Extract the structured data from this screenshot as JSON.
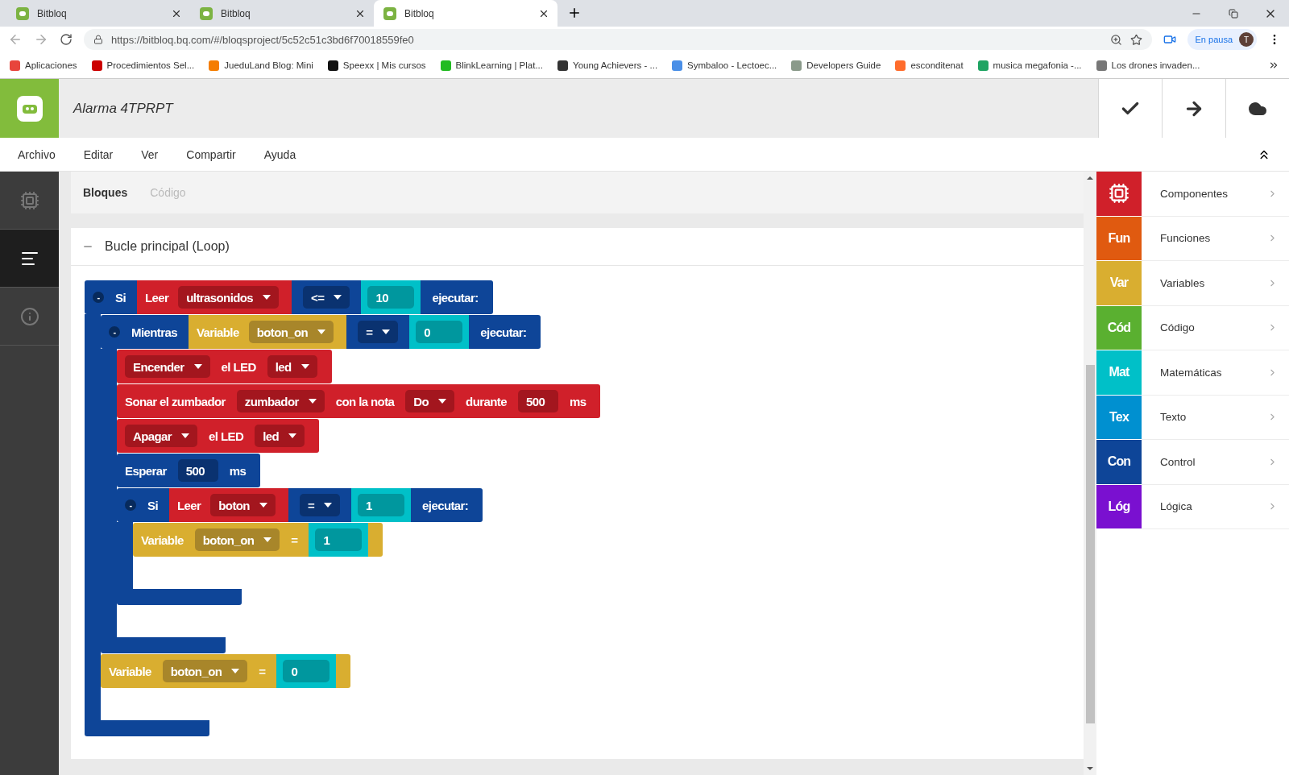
{
  "browser": {
    "tabs": [
      {
        "title": "Bitbloq",
        "selected": false
      },
      {
        "title": "Bitbloq",
        "selected": false
      },
      {
        "title": "Bitbloq",
        "selected": true
      }
    ],
    "url": "https://bitbloq.bq.com/#/bloqsproject/5c52c51c3bd6f70018559fe0",
    "profile": {
      "status": "En pausa",
      "initial": "T"
    },
    "bookmarks": [
      {
        "label": "Aplicaciones",
        "color": "#e8453c"
      },
      {
        "label": "Procedimientos Sel...",
        "color": "#cc0000"
      },
      {
        "label": "JueduLand Blog: Mini",
        "color": "#f57d00"
      },
      {
        "label": "Speexx | Mis cursos",
        "color": "#111111"
      },
      {
        "label": "BlinkLearning | Plat...",
        "color": "#22bb22"
      },
      {
        "label": "Young Achievers - ...",
        "color": "#333333"
      },
      {
        "label": "Symbaloo - Lectoec...",
        "color": "#4a8fe7"
      },
      {
        "label": "Developers Guide",
        "color": "#8a9a8a"
      },
      {
        "label": "esconditenat",
        "color": "#ff6c2c"
      },
      {
        "label": "musica megafonia -...",
        "color": "#1fa463"
      },
      {
        "label": "Los drones invaden...",
        "color": "#777777"
      }
    ]
  },
  "app": {
    "project_title": "Alarma 4TPRPT",
    "menu": [
      "Archivo",
      "Editar",
      "Ver",
      "Compartir",
      "Ayuda"
    ],
    "sidebar": [
      {
        "selected": false
      },
      {
        "selected": true
      },
      {
        "selected": false
      }
    ],
    "view_tabs": [
      {
        "label": "Bloques",
        "selected": true
      },
      {
        "label": "Código",
        "selected": false
      }
    ],
    "section": {
      "title": "Bucle principal (Loop)",
      "blocks": [
        {
          "kind": "control",
          "toggle": "-",
          "parts": [
            {
              "kind": "text",
              "text": "Si"
            },
            {
              "kind": "component_value",
              "parts": [
                {
                  "kind": "text",
                  "text": "Leer"
                },
                {
                  "kind": "dropdown",
                  "text": "ultrasonidos"
                }
              ]
            },
            {
              "kind": "dropdown",
              "text": "<="
            },
            {
              "kind": "socket",
              "text": "10"
            },
            {
              "kind": "text",
              "text": "ejecutar:"
            }
          ],
          "children": [
            {
              "kind": "control",
              "toggle": "-",
              "parts": [
                {
                  "kind": "text",
                  "text": "Mientras"
                },
                {
                  "kind": "variable_value",
                  "parts": [
                    {
                      "kind": "text",
                      "text": "Variable"
                    },
                    {
                      "kind": "dropdown",
                      "text": "boton_on"
                    }
                  ]
                },
                {
                  "kind": "dropdown",
                  "text": "="
                },
                {
                  "kind": "socket",
                  "text": "0"
                },
                {
                  "kind": "text",
                  "text": "ejecutar:"
                }
              ],
              "children": [
                {
                  "kind": "component",
                  "parts": [
                    {
                      "kind": "dropdown",
                      "text": "Encender"
                    },
                    {
                      "kind": "text",
                      "text": "el LED"
                    },
                    {
                      "kind": "dropdown",
                      "text": "led"
                    }
                  ]
                },
                {
                  "kind": "component",
                  "parts": [
                    {
                      "kind": "text",
                      "text": "Sonar el zumbador"
                    },
                    {
                      "kind": "dropdown",
                      "text": "zumbador"
                    },
                    {
                      "kind": "text",
                      "text": "con la nota"
                    },
                    {
                      "kind": "dropdown",
                      "text": "Do"
                    },
                    {
                      "kind": "text",
                      "text": "durante"
                    },
                    {
                      "kind": "number",
                      "text": "500"
                    },
                    {
                      "kind": "text",
                      "text": "ms"
                    }
                  ]
                },
                {
                  "kind": "component",
                  "parts": [
                    {
                      "kind": "dropdown",
                      "text": "Apagar"
                    },
                    {
                      "kind": "text",
                      "text": "el LED"
                    },
                    {
                      "kind": "dropdown",
                      "text": "led"
                    }
                  ]
                },
                {
                  "kind": "control",
                  "parts": [
                    {
                      "kind": "text",
                      "text": "Esperar"
                    },
                    {
                      "kind": "number",
                      "text": "500"
                    },
                    {
                      "kind": "text",
                      "text": "ms"
                    }
                  ]
                },
                {
                  "kind": "control",
                  "toggle": "-",
                  "parts": [
                    {
                      "kind": "text",
                      "text": "Si"
                    },
                    {
                      "kind": "component_value",
                      "parts": [
                        {
                          "kind": "text",
                          "text": "Leer"
                        },
                        {
                          "kind": "dropdown",
                          "text": "boton"
                        }
                      ]
                    },
                    {
                      "kind": "dropdown",
                      "text": "="
                    },
                    {
                      "kind": "socket",
                      "text": "1"
                    },
                    {
                      "kind": "text",
                      "text": "ejecutar:"
                    }
                  ],
                  "children": [
                    {
                      "kind": "variable",
                      "parts": [
                        {
                          "kind": "text",
                          "text": "Variable"
                        },
                        {
                          "kind": "dropdown",
                          "text": "boton_on"
                        },
                        {
                          "kind": "text",
                          "text": "="
                        },
                        {
                          "kind": "socket",
                          "text": "1"
                        }
                      ]
                    }
                  ]
                }
              ]
            },
            {
              "kind": "variable",
              "parts": [
                {
                  "kind": "text",
                  "text": "Variable"
                },
                {
                  "kind": "dropdown",
                  "text": "boton_on"
                },
                {
                  "kind": "text",
                  "text": "="
                },
                {
                  "kind": "socket",
                  "text": "0"
                }
              ]
            }
          ]
        }
      ]
    },
    "palette": [
      {
        "label": "Componentes",
        "color": "#d0202a"
      },
      {
        "badge": "Fun",
        "label": "Funciones",
        "color": "#e05a10"
      },
      {
        "badge": "Var",
        "label": "Variables",
        "color": "#d9ae30"
      },
      {
        "badge": "Cód",
        "label": "Código",
        "color": "#5ab030"
      },
      {
        "badge": "Mat",
        "label": "Matemáticas",
        "color": "#00c0c8"
      },
      {
        "badge": "Tex",
        "label": "Texto",
        "color": "#0090d0"
      },
      {
        "badge": "Con",
        "label": "Control",
        "color": "#0e4598"
      },
      {
        "badge": "Lóg",
        "label": "Lógica",
        "color": "#7a10d0"
      }
    ]
  }
}
